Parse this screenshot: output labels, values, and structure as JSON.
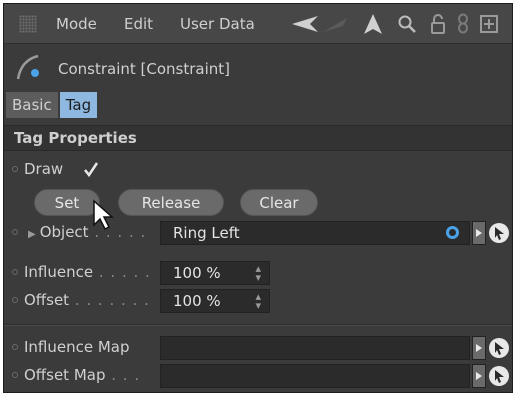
{
  "menu": {
    "mode": "Mode",
    "edit": "Edit",
    "user_data": "User Data"
  },
  "toolbar_icons": [
    "back-arrow-icon",
    "forward-arrow-icon",
    "up-arrow-icon",
    "search-icon",
    "lock-icon",
    "link-icon",
    "new-window-icon"
  ],
  "header": {
    "title": "Constraint [Constraint]"
  },
  "tabs": [
    {
      "label": "Basic",
      "active": false
    },
    {
      "label": "Tag",
      "active": true
    }
  ],
  "section": {
    "title": "Tag Properties"
  },
  "draw": {
    "label": "Draw",
    "checked": true
  },
  "buttons": {
    "set": "Set",
    "release": "Release",
    "clear": "Clear"
  },
  "object": {
    "label": "Object",
    "leader": " . . . . .",
    "value": "Ring Left"
  },
  "influence": {
    "label": "Influence",
    "leader": " . . . . .",
    "value": "100 %"
  },
  "offset": {
    "label": "Offset",
    "leader": " . . . . . . .",
    "value": "100 %"
  },
  "influence_map": {
    "label": "Influence Map",
    "value": ""
  },
  "offset_map": {
    "label": "Offset Map",
    "leader": " . . .",
    "value": ""
  },
  "colors": {
    "panel": "#3b3b3b",
    "active_tab": "#8fb8e0",
    "field": "#2b2b2b",
    "accent_blue": "#4aa3e8"
  }
}
